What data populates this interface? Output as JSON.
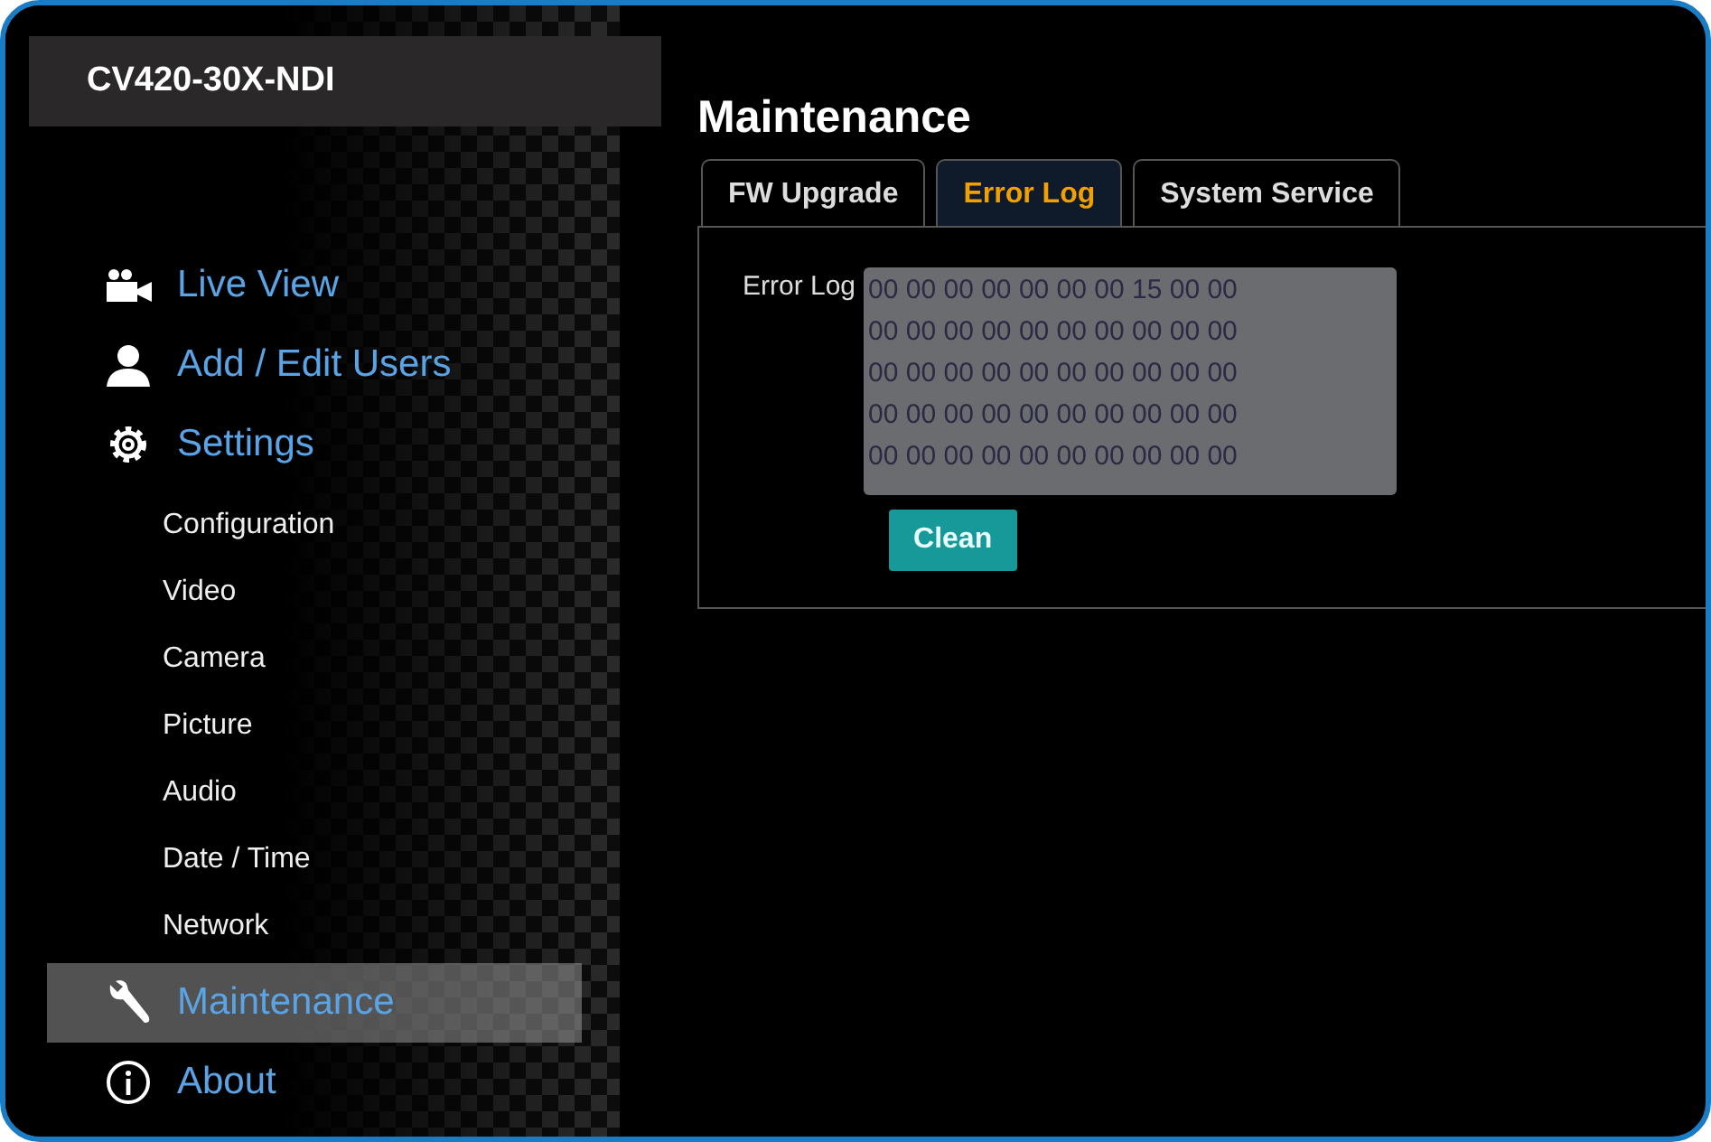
{
  "device_name": "CV420-30X-NDI",
  "sidebar": {
    "items": [
      {
        "label": "Live View",
        "selected": false
      },
      {
        "label": "Add / Edit Users",
        "selected": false
      },
      {
        "label": "Settings",
        "selected": false,
        "children": [
          {
            "label": "Configuration",
            "selected": false
          },
          {
            "label": "Video",
            "selected": false
          },
          {
            "label": "Camera",
            "selected": false
          },
          {
            "label": "Picture",
            "selected": false
          },
          {
            "label": "Audio",
            "selected": false
          },
          {
            "label": "Date / Time",
            "selected": false
          },
          {
            "label": "Network",
            "selected": false
          }
        ]
      },
      {
        "label": "Maintenance",
        "selected": true
      },
      {
        "label": "About",
        "selected": false
      }
    ]
  },
  "page_title": "Maintenance",
  "tabs": [
    {
      "label": "FW Upgrade",
      "selected": false
    },
    {
      "label": "Error Log",
      "selected": true
    },
    {
      "label": "System Service",
      "selected": false
    }
  ],
  "error_log": {
    "label": "Error Log",
    "value": "00 00 00 00 00 00 00 15 00 00\n00 00 00 00 00 00 00 00 00 00\n00 00 00 00 00 00 00 00 00 00\n00 00 00 00 00 00 00 00 00 00\n00 00 00 00 00 00 00 00 00 00"
  },
  "buttons": [
    {
      "label": "Clean"
    }
  ]
}
